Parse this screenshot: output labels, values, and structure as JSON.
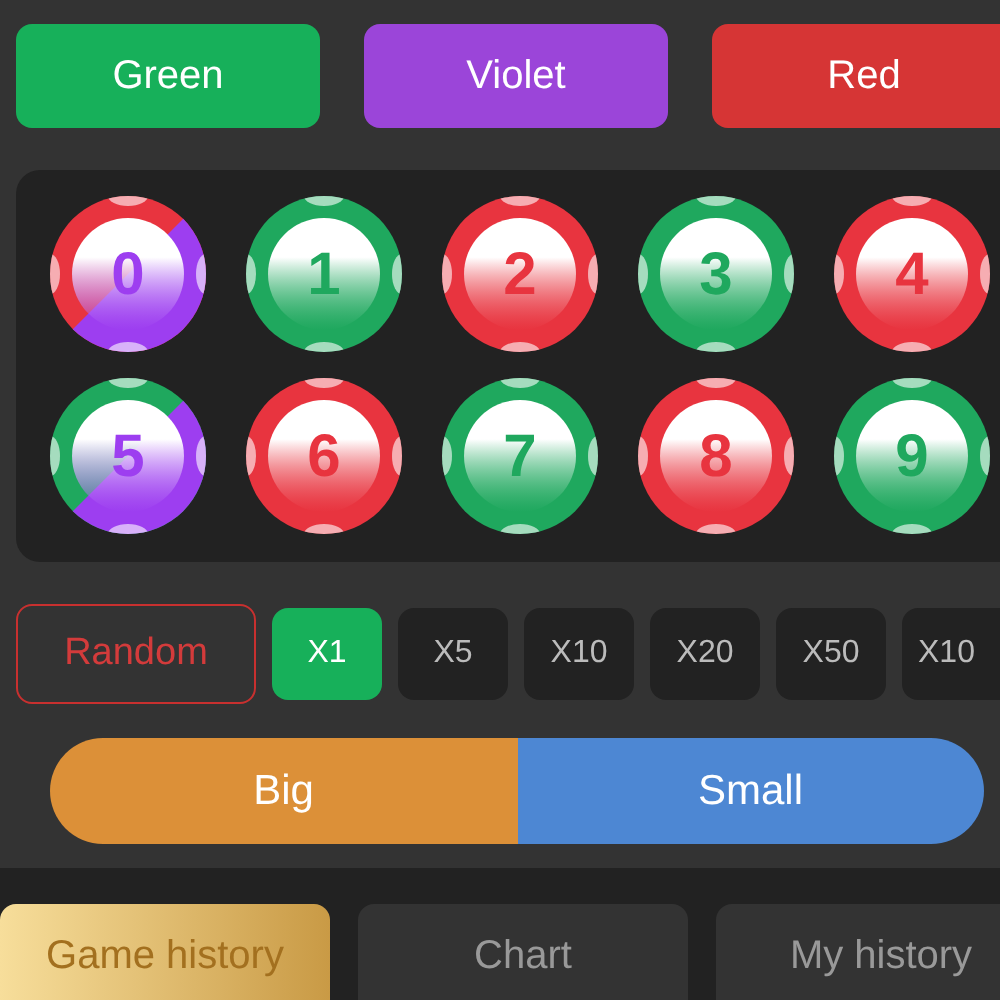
{
  "color_buttons": [
    {
      "label": "Green",
      "color": "#17b05a"
    },
    {
      "label": "Violet",
      "color": "#9b45d9"
    },
    {
      "label": "Red",
      "color": "#d63535"
    }
  ],
  "balls": [
    {
      "number": "0",
      "segments": [
        {
          "color": "#e8343f"
        },
        {
          "color": "#9d3ef0"
        }
      ]
    },
    {
      "number": "1",
      "segments": [
        {
          "color": "#1fa85e"
        }
      ]
    },
    {
      "number": "2",
      "segments": [
        {
          "color": "#e8343f"
        }
      ]
    },
    {
      "number": "3",
      "segments": [
        {
          "color": "#1fa85e"
        }
      ]
    },
    {
      "number": "4",
      "segments": [
        {
          "color": "#e8343f"
        }
      ]
    },
    {
      "number": "5",
      "segments": [
        {
          "color": "#1fa85e"
        },
        {
          "color": "#9d3ef0"
        }
      ]
    },
    {
      "number": "6",
      "segments": [
        {
          "color": "#e8343f"
        }
      ]
    },
    {
      "number": "7",
      "segments": [
        {
          "color": "#1fa85e"
        }
      ]
    },
    {
      "number": "8",
      "segments": [
        {
          "color": "#e8343f"
        }
      ]
    },
    {
      "number": "9",
      "segments": [
        {
          "color": "#1fa85e"
        }
      ]
    }
  ],
  "random_button": "Random",
  "multipliers": [
    {
      "label": "X1",
      "selected": true
    },
    {
      "label": "X5",
      "selected": false
    },
    {
      "label": "X10",
      "selected": false
    },
    {
      "label": "X20",
      "selected": false
    },
    {
      "label": "X50",
      "selected": false
    },
    {
      "label": "X10",
      "selected": false
    }
  ],
  "size_buttons": [
    {
      "label": "Big",
      "color": "#dc9038"
    },
    {
      "label": "Small",
      "color": "#4d87d3"
    }
  ],
  "tabs": [
    {
      "label": "Game history",
      "selected": true
    },
    {
      "label": "Chart",
      "selected": false
    },
    {
      "label": "My history",
      "selected": false
    }
  ]
}
